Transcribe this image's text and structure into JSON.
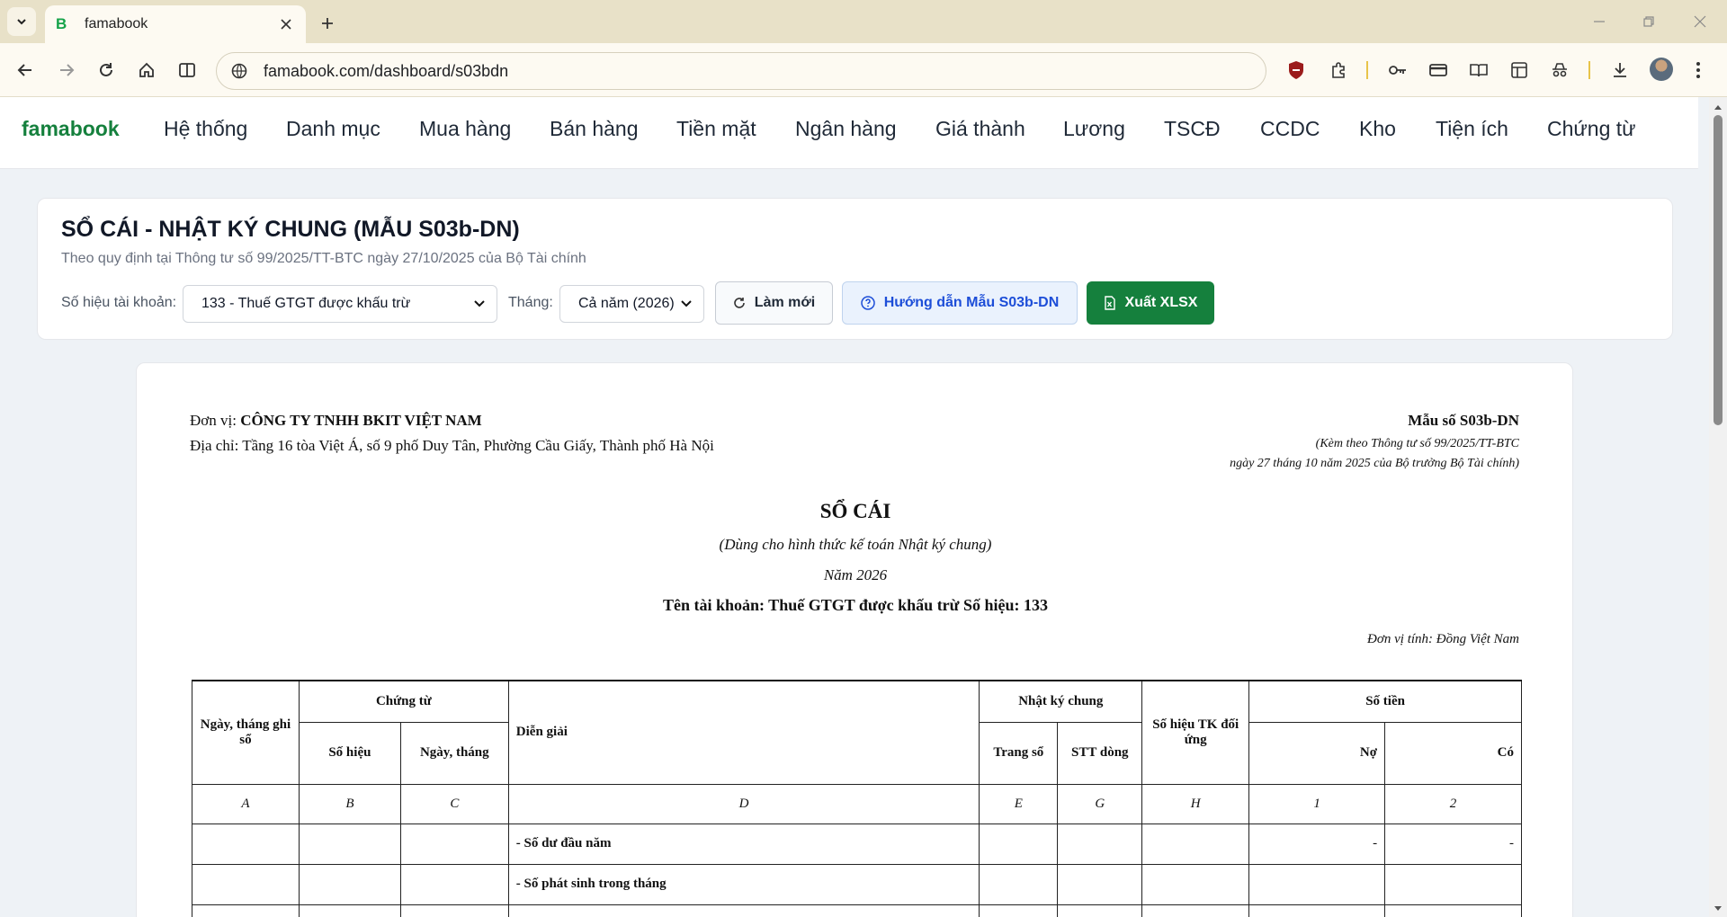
{
  "browser": {
    "tab_title": "famabook",
    "favicon_letter": "B",
    "url": "famabook.com/dashboard/s03bdn"
  },
  "nav": {
    "brand": "famabook",
    "items": [
      "Hệ thống",
      "Danh mục",
      "Mua hàng",
      "Bán hàng",
      "Tiền mặt",
      "Ngân hàng",
      "Giá thành",
      "Lương",
      "TSCĐ",
      "CCDC",
      "Kho",
      "Tiện ích",
      "Chứng từ"
    ]
  },
  "panel": {
    "title": "SỔ CÁI - NHẬT KÝ CHUNG (MẪU S03b-DN)",
    "subtitle": "Theo quy định tại Thông tư số 99/2025/TT-BTC ngày 27/10/2025 của Bộ Tài chính",
    "account_label": "Số hiệu tài khoản:",
    "account_value": "133 - Thuế GTGT được khấu trừ",
    "month_label": "Tháng:",
    "month_value": "Cả năm (2026)",
    "refresh_label": "Làm mới",
    "guide_label": "Hướng dẫn Mẫu S03b-DN",
    "export_label": "Xuất XLSX"
  },
  "doc": {
    "unit_label": "Đơn vị:",
    "unit_name": "CÔNG TY TNHH BKIT VIỆT NAM",
    "address": "Địa chỉ: Tầng 16 tòa Việt Á, số 9 phố Duy Tân, Phường Cầu Giấy, Thành phố Hà Nội",
    "form_no": "Mẫu số S03b-DN",
    "form_note1": "(Kèm theo Thông tư số 99/2025/TT-BTC",
    "form_note2": "ngày 27 tháng 10 năm 2025 của Bộ trưởng Bộ Tài chính)",
    "title": "SỔ CÁI",
    "subtitle": "(Dùng cho hình thức kế toán Nhật ký chung)",
    "year": "Năm 2026",
    "account_line": "Tên tài khoản: Thuế GTGT được khấu trừ Số hiệu: 133",
    "currency": "Đơn vị tính: Đồng Việt Nam"
  },
  "table": {
    "h_date": "Ngày, tháng ghi sổ",
    "h_voucher": "Chứng từ",
    "h_voucher_no": "Số hiệu",
    "h_voucher_date": "Ngày, tháng",
    "h_desc": "Diễn giải",
    "h_journal": "Nhật ký chung",
    "h_page": "Trang sổ",
    "h_line": "STT dòng",
    "h_counter": "Số hiệu TK đối ứng",
    "h_amount": "Số tiền",
    "h_debit": "Nợ",
    "h_credit": "Có",
    "codes": [
      "A",
      "B",
      "C",
      "D",
      "E",
      "G",
      "H",
      "1",
      "2"
    ],
    "rows": [
      {
        "desc": "- Số dư đầu năm",
        "debit": "-",
        "credit": "-"
      },
      {
        "desc": "- Số phát sinh trong tháng",
        "debit": "",
        "credit": ""
      }
    ]
  }
}
